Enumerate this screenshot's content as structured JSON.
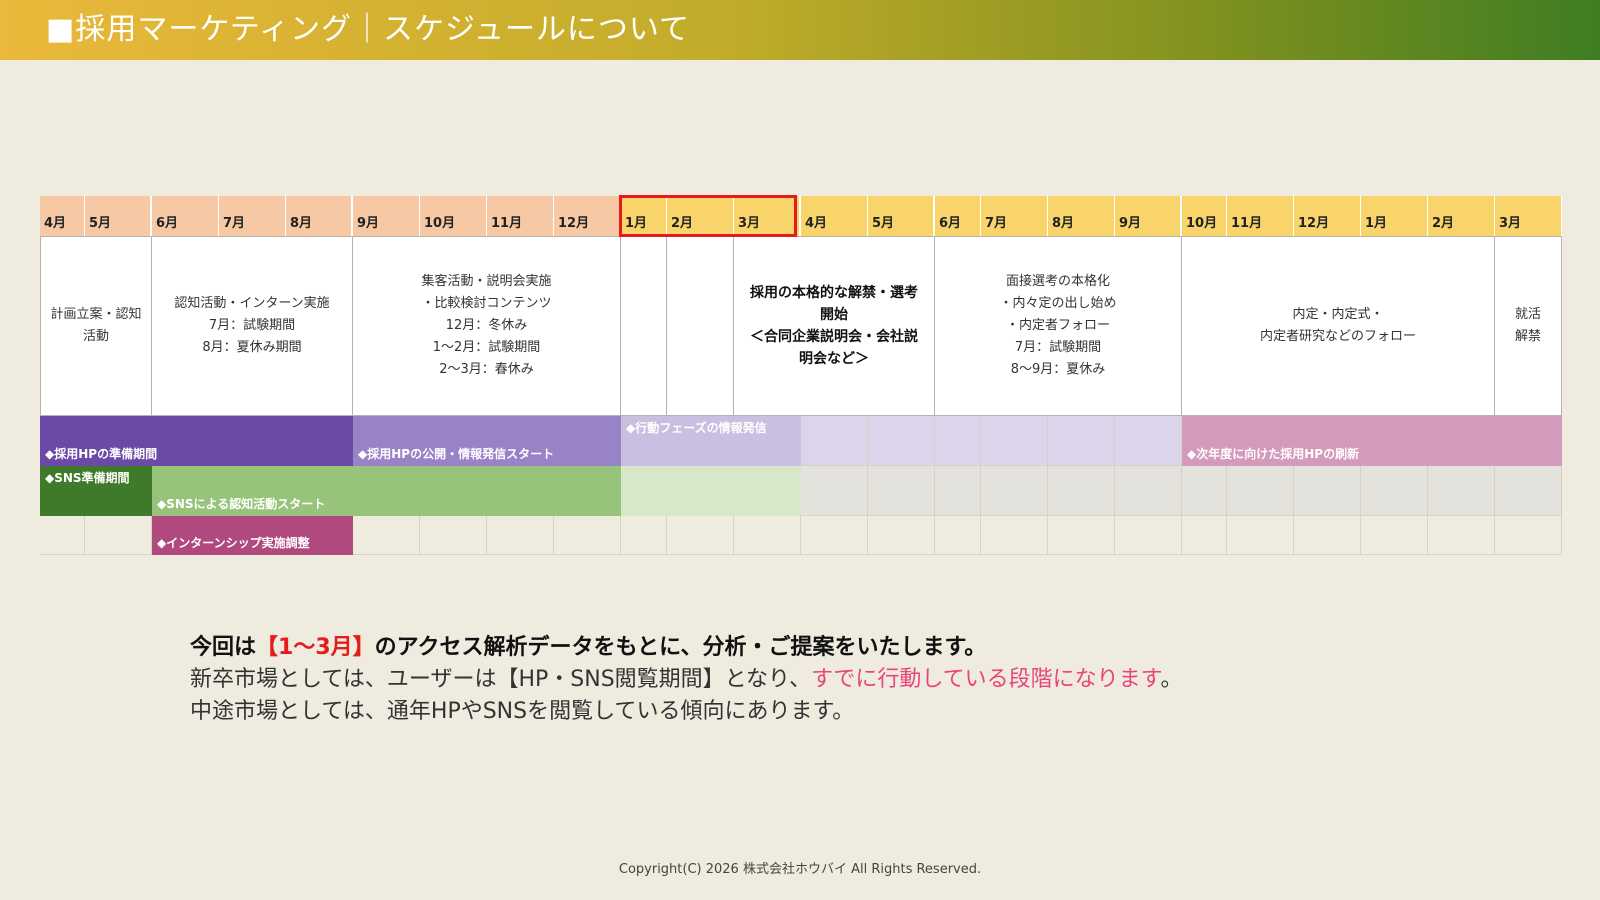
{
  "header": {
    "title": "■採用マーケティング｜スケジュールについて",
    "gradient": [
      "#eab83a",
      "#82921f",
      "#3f7d22"
    ]
  },
  "schedule": {
    "months": [
      {
        "label": "4月",
        "color": "#f6c8a3"
      },
      {
        "label": "5月",
        "color": "#f6c8a3"
      },
      {
        "label": "6月",
        "color": "#f6c8a3"
      },
      {
        "label": "7月",
        "color": "#f6c8a3"
      },
      {
        "label": "8月",
        "color": "#f6c8a3"
      },
      {
        "label": "9月",
        "color": "#f6c8a3"
      },
      {
        "label": "10月",
        "color": "#f6c8a3"
      },
      {
        "label": "11月",
        "color": "#f6c8a3"
      },
      {
        "label": "12月",
        "color": "#f6c8a3"
      },
      {
        "label": "1月",
        "color": "#f8d46a"
      },
      {
        "label": "2月",
        "color": "#f8d46a"
      },
      {
        "label": "3月",
        "color": "#f8d46a"
      },
      {
        "label": "4月",
        "color": "#f8d46a"
      },
      {
        "label": "5月",
        "color": "#f8d46a"
      },
      {
        "label": "6月",
        "color": "#f8d46a"
      },
      {
        "label": "7月",
        "color": "#f8d46a"
      },
      {
        "label": "8月",
        "color": "#f8d46a"
      },
      {
        "label": "9月",
        "color": "#f8d46a"
      },
      {
        "label": "10月",
        "color": "#f8d46a"
      },
      {
        "label": "11月",
        "color": "#f8d46a"
      },
      {
        "label": "12月",
        "color": "#f8d46a"
      },
      {
        "label": "1月",
        "color": "#f8d46a"
      },
      {
        "label": "2月",
        "color": "#f8d46a"
      },
      {
        "label": "3月",
        "color": "#f8d46a"
      }
    ],
    "highlight_label": "1〜3月",
    "highlight_color": "#e51c1c",
    "phases": [
      {
        "text": "計画立案・認知\n活動",
        "bold": false
      },
      {
        "text": "認知活動・インターン実施\n7月：試験期間\n8月：夏休み期間",
        "bold": false
      },
      {
        "text": "集客活動・説明会実施\n・比較検討コンテンツ\n12月：冬休み\n1〜2月：試験期間\n2〜3月：春休み",
        "bold": false
      },
      {
        "text": "",
        "bold": false
      },
      {
        "text": "",
        "bold": false
      },
      {
        "text": "採用の本格的な解禁・選考\n開始\n＜合同企業説明会・会社説\n明会など＞",
        "bold": true
      },
      {
        "text": "面接選考の本格化\n・内々定の出し始め\n・内定者フォロー\n7月：試験期間\n8〜9月：夏休み",
        "bold": false
      },
      {
        "text": "内定・内定式・\n内定者研究などのフォロー",
        "bold": false
      },
      {
        "text": "就活\n解禁",
        "bold": false
      }
    ],
    "bars": [
      {
        "label": "◆採用HPの準備期間",
        "color": "#6a4aa6"
      },
      {
        "label": "◆採用HPの公開・情報発信スタート",
        "color": "#9a82c6"
      },
      {
        "label": "◆行動フェーズの情報発信",
        "color": "#c9bfe0"
      },
      {
        "label": "◆次年度に向けた採用HPの刷新",
        "color": "#d39abb"
      },
      {
        "label": "◆SNS準備期間",
        "color": "#3f7a2a"
      },
      {
        "label": "◆SNSによる認知活動スタート",
        "color": "#97c47a"
      },
      {
        "label": "",
        "color": "#d6e8c8"
      },
      {
        "label": "◆インターンシップ実施調整",
        "color": "#b0497e"
      }
    ]
  },
  "message": {
    "line1_a": "今回は",
    "line1_b": "【1〜3月】",
    "line1_c": "のアクセス解析データをもとに、分析・ご提案をいたします。",
    "line2_a": "新卒市場としては、ユーザーは【HP・SNS閲覧期間】となり、",
    "line2_b": "すでに行動している段階になります",
    "line2_c": "。",
    "line3": "中途市場としては、通年HPやSNSを閲覧している傾向にあります。",
    "accent_red": "#e51c1c",
    "accent_pink": "#e8467a"
  },
  "footer": {
    "copyright": "Copyright(C) 2026 株式会社ホウバイ All Rights Reserved."
  }
}
